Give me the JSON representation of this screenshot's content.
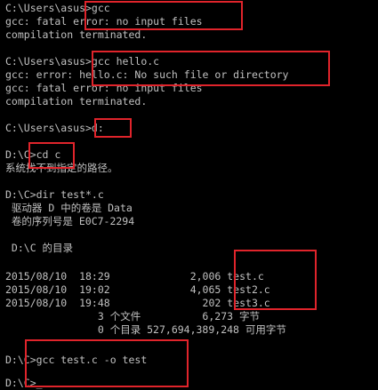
{
  "console": {
    "lines": [
      "C:\\Users\\asus>gcc",
      "gcc: fatal error: no input files",
      "compilation terminated.",
      "",
      "C:\\Users\\asus>gcc hello.c",
      "gcc: error: hello.c: No such file or directory",
      "gcc: fatal error: no input files",
      "compilation terminated.",
      "",
      "C:\\Users\\asus>d:",
      "",
      "D:\\C>cd c",
      "系统找不到指定的路径。",
      "",
      "D:\\C>dir test*.c",
      " 驱动器 D 中的卷是 Data",
      " 卷的序列号是 E0C7-2294",
      "",
      " D:\\C 的目录",
      "",
      "2015/08/10  18:29             2,006 test.c",
      "2015/08/10  19:02             4,065 test2.c",
      "2015/08/10  19:48               202 test3.c",
      "               3 个文件          6,273 字节",
      "               0 个目录 527,694,389,248 可用字节",
      "",
      "D:\\C>gcc test.c -o test",
      "",
      "D:\\C>_"
    ]
  },
  "colors": {
    "background": "#000000",
    "text": "#c0c0c0",
    "highlight": "#e0242b"
  }
}
